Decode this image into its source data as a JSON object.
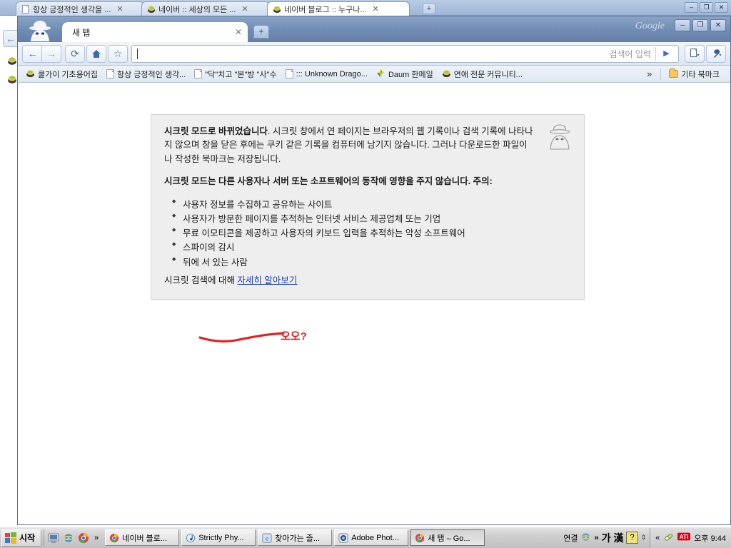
{
  "rear_window": {
    "tabs": [
      {
        "title": "항상 긍정적인 생각을 ...",
        "icon": "document-icon",
        "active": false
      },
      {
        "title": "네이버 :: 세상의 모든 ...",
        "icon": "naver-icon",
        "active": false
      },
      {
        "title": "네이버 블로그 :: 누구나...",
        "icon": "naver-icon",
        "active": true
      }
    ],
    "new_tab_label": "+",
    "window_buttons": [
      "–",
      "❐",
      "✕"
    ]
  },
  "chrome_window": {
    "brand": "Google",
    "window_buttons": {
      "minimize": "–",
      "maximize": "❐",
      "close": "✕"
    },
    "tab": {
      "title": "새 탭",
      "close_label": "✕"
    },
    "new_tab_label": "+",
    "toolbar": {
      "back_label": "←",
      "forward_label": "→",
      "reload_label": "⟳",
      "home_label": "⌂",
      "bookmark_star_label": "☆",
      "address_value": "",
      "address_placeholder": "",
      "search_hint": "검색어 입력",
      "go_label": "▶",
      "page_menu_label": "▾",
      "wrench_menu_label": "▾"
    },
    "bookmarks": [
      {
        "label": "쿨가이 기초용어집",
        "icon": "naver-icon"
      },
      {
        "label": "항상 긍정적인 생각...",
        "icon": "document-icon"
      },
      {
        "label": "\"닥\"치고 \"본\"방 \"사\"수",
        "icon": "document-icon"
      },
      {
        "label": "::: Unknown Drago...",
        "icon": "document-icon"
      },
      {
        "label": "Daum 한메일",
        "icon": "daum-icon"
      },
      {
        "label": "연애 전문 커뮤니티...",
        "icon": "naver-icon"
      }
    ],
    "bookmarks_overflow_label": "»",
    "other_bookmarks": {
      "label": "기타 북마크",
      "icon": "folder-icon"
    }
  },
  "incognito_page": {
    "heading1": "시크릿 모드로 바뀌었습니다",
    "paragraph1": ". 시크릿 창에서 연 페이지는 브라우저의 웹 기록이나 검색 기록에 나타나지 않으며 창을 닫은 후에는 쿠키 같은 기록을 컴퓨터에 남기지 않습니다. 그러나 다운로드한 파일이나 작성한 북마크는 저장됩니다.",
    "heading2": "시크릿 모드는 다른 사용자나 서버 또는 소프트웨어의 동작에 영향을 주지 않습니다. 주의:",
    "bullets": [
      "사용자 정보를 수집하고 공유하는 사이트",
      "사용자가 방문한 페이지를 추적하는 인터넷 서비스 제공업체 또는 기업",
      "무료 이모티콘을 제공하고 사용자의 키보드 입력을 추적하는 악성 소프트웨어",
      "스파이의 감시",
      "뒤에 서 있는 사람"
    ],
    "footer_prefix": "시크릿 검색에 대해 ",
    "footer_link": "자세히 알아보기",
    "annotation": "오오?"
  },
  "taskbar": {
    "start_label": "시작",
    "quick_launch_icons": [
      "desktop-icon",
      "internet-explorer-icon",
      "chrome-icon"
    ],
    "quick_launch_more": "»",
    "tasks": [
      {
        "label": "네이버 블로...",
        "icon": "chrome-icon",
        "active": false
      },
      {
        "label": "Strictly Phy...",
        "icon": "music-icon",
        "active": false
      },
      {
        "label": "찾아가는 즐...",
        "icon": "internet-explorer-icon",
        "active": false
      },
      {
        "label": "Adobe Phot...",
        "icon": "photoshop-icon",
        "active": false
      },
      {
        "label": "새 탭 – Go...",
        "icon": "chrome-icon",
        "active": true
      }
    ],
    "tray": {
      "connection_label": "연결",
      "ie_icon": "internet-explorer-icon",
      "overflow": "»",
      "ime_mode": "가",
      "ime_hanja": "漢",
      "help_label": "?",
      "ime_expand": "⇕",
      "hidden_chevron": "«",
      "pill_icon": "pill-icon",
      "ati_label": "ATI",
      "clock": "오후 9:44"
    }
  }
}
